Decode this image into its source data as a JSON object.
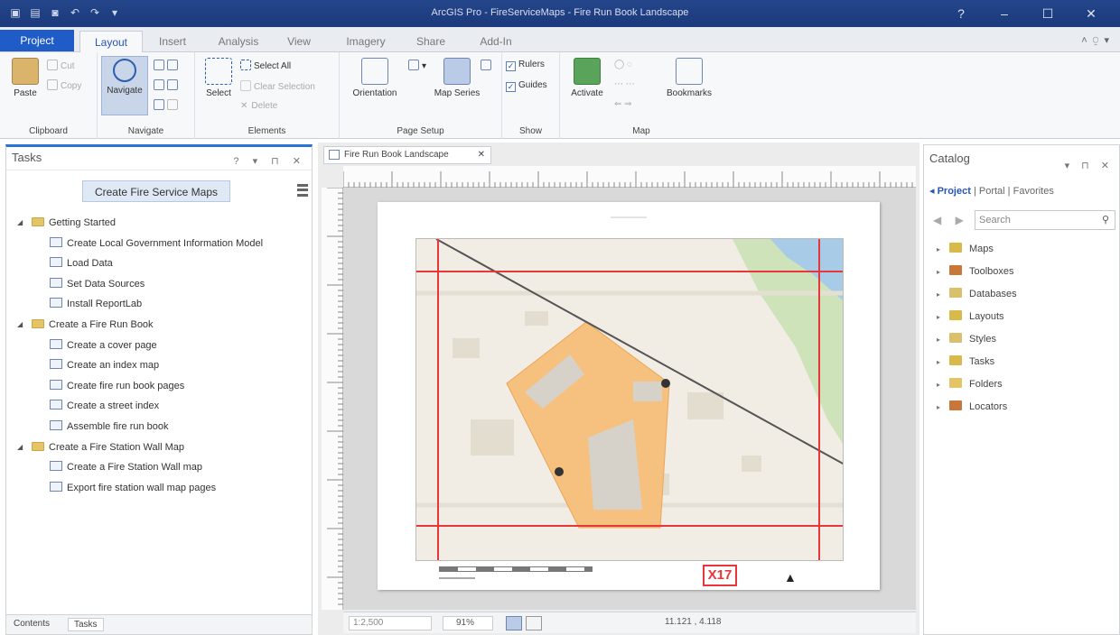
{
  "window": {
    "title": "ArcGIS Pro - FireServiceMaps - Fire Run Book Landscape",
    "controls": [
      "?",
      "–",
      "☐",
      "✕"
    ]
  },
  "ribbon_tabs": [
    "Project",
    "Layout",
    "Insert",
    "Analysis",
    "View",
    "Imagery",
    "Share",
    "Add-In"
  ],
  "ribbon": {
    "clipboard": {
      "label": "Clipboard",
      "paste": "Paste",
      "cut": "Cut",
      "copy": "Copy"
    },
    "navigate": {
      "label": "Navigate",
      "navigate_btn": "Navigate"
    },
    "elements": {
      "label": "Elements",
      "select": "Select",
      "select_all": "Select All",
      "clear_selection": "Clear Selection",
      "delete": "Delete"
    },
    "page_setup": {
      "label": "Page Setup",
      "orientation": "Orientation",
      "map_series": "Map Series"
    },
    "show": {
      "label": "Show",
      "rulers": "Rulers",
      "guides": "Guides"
    },
    "map": {
      "label": "Map",
      "activate": "Activate",
      "bookmarks": "Bookmarks"
    }
  },
  "tasks_pane": {
    "title": "Tasks",
    "button": "Create Fire Service Maps",
    "groups": [
      {
        "name": "Getting Started",
        "items": [
          "Create Local Government Information Model",
          "Load Data",
          "Set Data Sources",
          "Install ReportLab"
        ]
      },
      {
        "name": "Create a Fire Run Book",
        "items": [
          "Create a cover page",
          "Create an index map",
          "Create fire run book pages",
          "Create a street index",
          "Assemble fire run book"
        ]
      },
      {
        "name": "Create a Fire Station Wall Map",
        "items": [
          "Create a Fire Station Wall map",
          "Export fire station wall map pages"
        ]
      }
    ],
    "bottom_tabs": [
      "Contents",
      "Tasks"
    ]
  },
  "layout_view": {
    "tab_title": "Fire Run Book Landscape",
    "page_label": "X17",
    "statusbar": {
      "scale": "1:2,500",
      "zoom": "91%",
      "coordinates": "11.121 , 4.118"
    }
  },
  "catalog_pane": {
    "title": "Catalog",
    "subtabs": [
      "Project",
      "Portal",
      "Favorites"
    ],
    "search_placeholder": "Search",
    "items": [
      {
        "label": "Maps",
        "icon": "maps-icon",
        "color": "#d9b94a"
      },
      {
        "label": "Toolboxes",
        "icon": "toolboxes-icon",
        "color": "#c9763a"
      },
      {
        "label": "Databases",
        "icon": "databases-icon",
        "color": "#d9c06a"
      },
      {
        "label": "Layouts",
        "icon": "layouts-icon",
        "color": "#d9b94a"
      },
      {
        "label": "Styles",
        "icon": "styles-icon",
        "color": "#d9c06a"
      },
      {
        "label": "Tasks",
        "icon": "tasks-icon",
        "color": "#d9b94a"
      },
      {
        "label": "Folders",
        "icon": "folders-icon",
        "color": "#e5c466"
      },
      {
        "label": "Locators",
        "icon": "locators-icon",
        "color": "#c9763a"
      }
    ]
  },
  "colors": {
    "title_bar": "#1c3a7c",
    "project_tab": "#1f5cc7",
    "accent": "#2a72d6",
    "grid_line": "#e8363a",
    "parcel": "#f6c07e"
  }
}
